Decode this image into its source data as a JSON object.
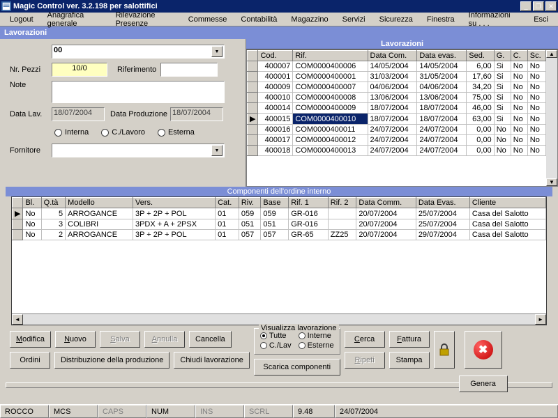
{
  "app": {
    "title": "Magic Control ver. 3.2.198 per salottifici"
  },
  "menu": [
    "Logout",
    "Anagrafica generale",
    "Rilevazione Presenze",
    "Commesse",
    "Contabilità",
    "Magazzino",
    "Servizi",
    "Sicurezza",
    "Finestra",
    "Informazioni su . . .",
    "Esci"
  ],
  "panel": {
    "title": "Lavorazioni"
  },
  "form": {
    "combo1": "00",
    "nr_pezzi_label": "Nr. Pezzi",
    "nr_pezzi": "10/0",
    "riferimento_label": "Riferimento",
    "riferimento": "",
    "note_label": "Note",
    "note": "",
    "data_lav_label": "Data Lav.",
    "data_lav": "18/07/2004",
    "data_prod_label": "Data Produzione",
    "data_prod": "18/07/2004",
    "radios": {
      "interna": "Interna",
      "clavoro": "C./Lavoro",
      "esterna": "Esterna"
    },
    "fornitore_label": "Fornitore",
    "fornitore": ""
  },
  "lav_grid": {
    "title": "Lavorazioni",
    "cols": [
      "Cod.",
      "Rif.",
      "Data Com.",
      "Data evas.",
      "Sed.",
      "G.",
      "C.",
      "Sc."
    ],
    "rows": [
      [
        "400007",
        "COM0000400006",
        "14/05/2004",
        "14/05/2004",
        "6,00",
        "Si",
        "No",
        "No"
      ],
      [
        "400001",
        "COM0000400001",
        "31/03/2004",
        "31/05/2004",
        "17,60",
        "Si",
        "No",
        "No"
      ],
      [
        "400009",
        "COM0000400007",
        "04/06/2004",
        "04/06/2004",
        "34,20",
        "Si",
        "No",
        "No"
      ],
      [
        "400010",
        "COM0000400008",
        "13/06/2004",
        "13/06/2004",
        "75,00",
        "Si",
        "No",
        "No"
      ],
      [
        "400014",
        "COM0000400009",
        "18/07/2004",
        "18/07/2004",
        "46,00",
        "Si",
        "No",
        "No"
      ],
      [
        "400015",
        "COM0000400010",
        "18/07/2004",
        "18/07/2004",
        "63,00",
        "Si",
        "No",
        "No"
      ],
      [
        "400016",
        "COM0000400011",
        "24/07/2004",
        "24/07/2004",
        "0,00",
        "No",
        "No",
        "No"
      ],
      [
        "400017",
        "COM0000400012",
        "24/07/2004",
        "24/07/2004",
        "0,00",
        "No",
        "No",
        "No"
      ],
      [
        "400018",
        "COM0000400013",
        "24/07/2004",
        "24/07/2004",
        "0,00",
        "No",
        "No",
        "No"
      ]
    ],
    "selected_row": 5
  },
  "comp": {
    "title": "Componenti dell'ordine interno",
    "cols": [
      "Bl.",
      "Q.tà",
      "Modello",
      "Vers.",
      "Cat.",
      "Riv.",
      "Base",
      "Rif. 1",
      "Rif. 2",
      "Data Comm.",
      "Data Evas.",
      "Cliente"
    ],
    "rows": [
      [
        "No",
        "5",
        "ARROGANCE",
        "3P + 2P + POL",
        "01",
        "059",
        "059",
        "GR-016",
        "",
        "20/07/2004",
        "25/07/2004",
        "Casa del Salotto"
      ],
      [
        "No",
        "3",
        "COLIBRI",
        "3PDX + A + 2PSX",
        "01",
        "051",
        "051",
        "GR-016",
        "",
        "20/07/2004",
        "25/07/2004",
        "Casa del Salotto"
      ],
      [
        "No",
        "2",
        "ARROGANCE",
        "3P + 2P + POL",
        "01",
        "057",
        "057",
        "GR-65",
        "ZZ25",
        "20/07/2004",
        "29/07/2004",
        "Casa del Salotto"
      ]
    ]
  },
  "buttons": {
    "modifica": "Modifica",
    "nuovo": "Nuovo",
    "salva": "Salva",
    "annulla": "Annulla",
    "cancella": "Cancella",
    "ordini": "Ordini",
    "distribuzione": "Distribuzione della produzione",
    "chiudi_lav": "Chiudi lavorazione",
    "cerca": "Cerca",
    "fattura": "Fattura",
    "ripeti": "Ripeti",
    "stampa": "Stampa",
    "scarica": "Scarica componenti",
    "genera": "Genera"
  },
  "visual": {
    "legend": "Visualizza lavorazione",
    "tutte": "Tutte",
    "interne": "Interne",
    "clav": "C./Lav",
    "esterne": "Esterne"
  },
  "status": {
    "user": "ROCCO",
    "ws": "MCS",
    "caps": "CAPS",
    "num": "NUM",
    "ins": "INS",
    "scrl": "SCRL",
    "time": "9.48",
    "date": "24/07/2004"
  }
}
